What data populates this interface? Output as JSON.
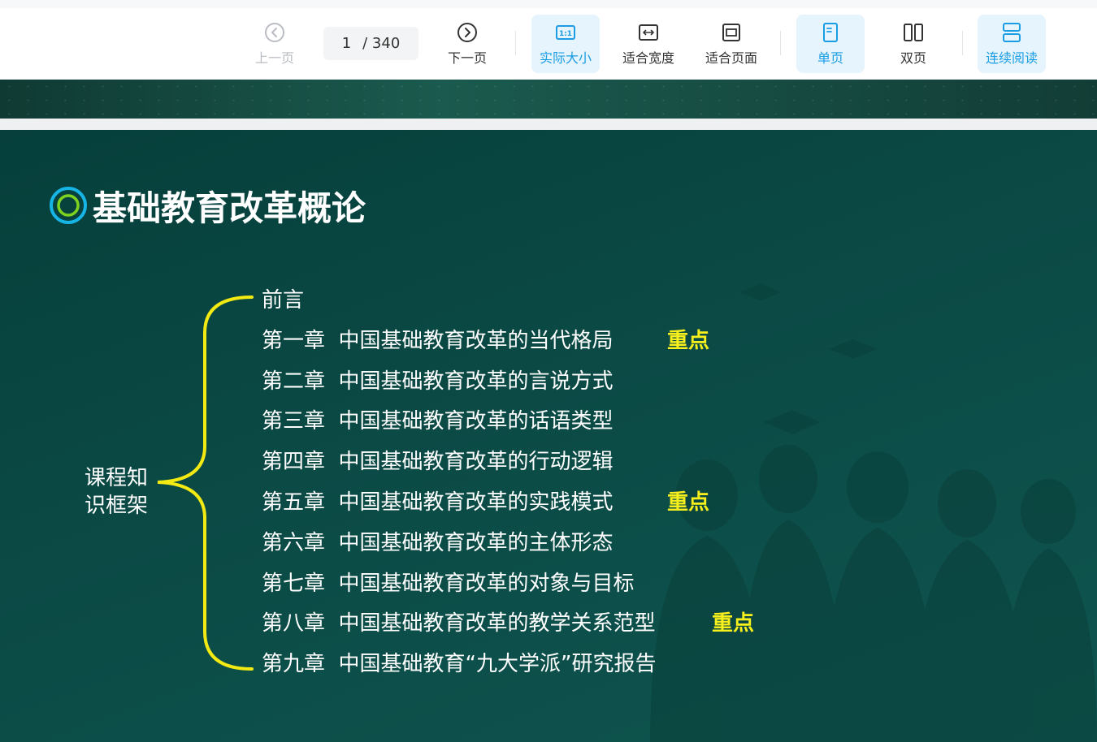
{
  "toolbar": {
    "prev_label": "上一页",
    "next_label": "下一页",
    "current_page": "1",
    "total_pages": "/ 340",
    "actual_size_label": "实际大小",
    "actual_size_icon_text": "1:1",
    "fit_width_label": "适合宽度",
    "fit_page_label": "适合页面",
    "single_page_label": "单页",
    "double_page_label": "双页",
    "continuous_label": "连续阅读",
    "accent_color": "#1a9de3"
  },
  "slide": {
    "title": "基础教育改革概论",
    "root_label_line1": "课程知",
    "root_label_line2": "识框架",
    "chapters": [
      {
        "text": "前言",
        "key": ""
      },
      {
        "text": "第一章  中国基础教育改革的当代格局",
        "key": "重点"
      },
      {
        "text": "第二章  中国基础教育改革的言说方式",
        "key": ""
      },
      {
        "text": "第三章  中国基础教育改革的话语类型",
        "key": ""
      },
      {
        "text": "第四章  中国基础教育改革的行动逻辑",
        "key": ""
      },
      {
        "text": "第五章  中国基础教育改革的实践模式",
        "key": "重点"
      },
      {
        "text": "第六章  中国基础教育改革的主体形态",
        "key": ""
      },
      {
        "text": "第七章  中国基础教育改革的对象与目标",
        "key": ""
      },
      {
        "text": "第八章  中国基础教育改革的教学关系范型",
        "key": "重点"
      },
      {
        "text": "第九章  中国基础教育“九大学派”研究报告",
        "key": ""
      }
    ],
    "background_color": "#0b4a45",
    "brace_color": "#f2ea12",
    "key_color": "#f7f01c"
  }
}
